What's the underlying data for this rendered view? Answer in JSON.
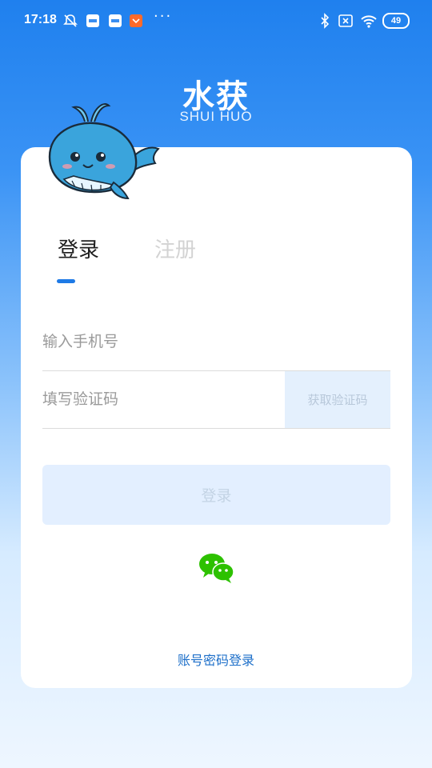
{
  "status_bar": {
    "time": "17:18",
    "battery": "49",
    "more": "···"
  },
  "app": {
    "title": "水获",
    "subtitle": "SHUI HUO"
  },
  "tabs": {
    "login": "登录",
    "register": "注册",
    "active": "login"
  },
  "form": {
    "phone_placeholder": "输入手机号",
    "code_placeholder": "填写验证码",
    "get_code_label": "获取验证码",
    "login_button": "登录"
  },
  "alt_login": {
    "wechat_icon": "wechat-icon",
    "password_login": "账号密码登录"
  },
  "colors": {
    "accent": "#1e7ae6",
    "wechat": "#2dc100",
    "link": "#1d6fc9"
  }
}
